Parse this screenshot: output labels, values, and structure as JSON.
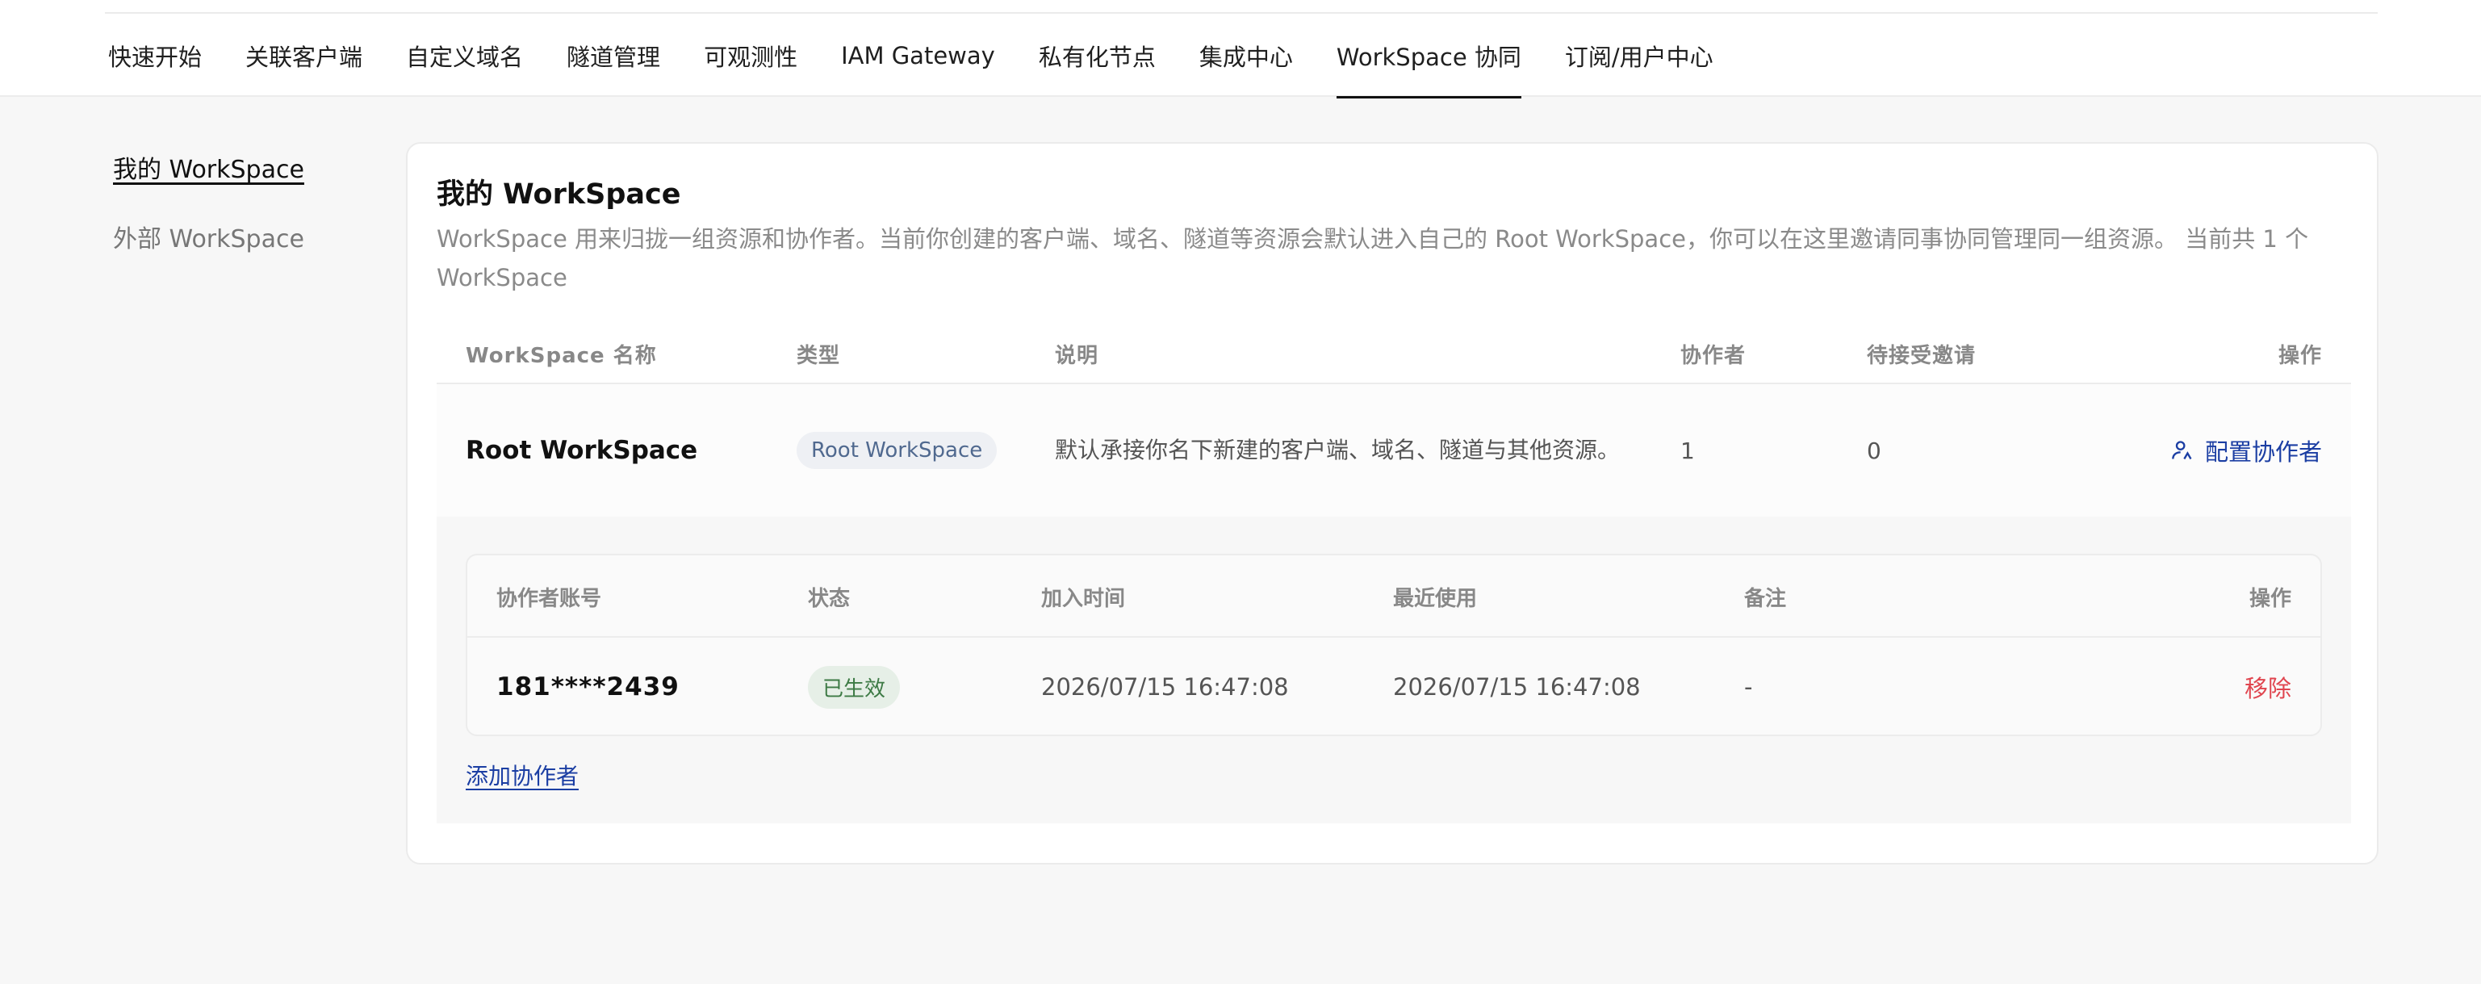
{
  "nav": {
    "tabs": [
      {
        "label": "快速开始"
      },
      {
        "label": "关联客户端"
      },
      {
        "label": "自定义域名"
      },
      {
        "label": "隧道管理"
      },
      {
        "label": "可观测性"
      },
      {
        "label": "IAM Gateway"
      },
      {
        "label": "私有化节点"
      },
      {
        "label": "集成中心"
      },
      {
        "label": "WorkSpace 协同",
        "active": true
      },
      {
        "label": "订阅/用户中心"
      }
    ]
  },
  "sidebar": {
    "items": [
      {
        "label": "我的 WorkSpace",
        "active": true
      },
      {
        "label": "外部 WorkSpace"
      }
    ]
  },
  "main": {
    "title": "我的 WorkSpace",
    "description": "WorkSpace 用来归拢一组资源和协作者。当前你创建的客户端、域名、隧道等资源会默认进入自己的 Root WorkSpace，你可以在这里邀请同事协同管理同一组资源。 当前共 1 个 WorkSpace",
    "table": {
      "headers": {
        "name": "WorkSpace 名称",
        "type": "类型",
        "desc": "说明",
        "collaborators": "协作者",
        "pending": "待接受邀请",
        "actions": "操作"
      },
      "row": {
        "name": "Root WorkSpace",
        "type": "Root WorkSpace",
        "desc": "默认承接你名下新建的客户端、域名、隧道与其他资源。",
        "collaborators": "1",
        "pending": "0",
        "action": "配置协作者"
      }
    },
    "collaborators": {
      "headers": {
        "account": "协作者账号",
        "status": "状态",
        "joined": "加入时间",
        "last_used": "最近使用",
        "note": "备注",
        "actions": "操作"
      },
      "row": {
        "account": "181****2439",
        "status": "已生效",
        "joined": "2026/07/15 16:47:08",
        "last_used": "2026/07/15 16:47:08",
        "note": "-",
        "action": "移除"
      },
      "add_label": "添加协作者"
    }
  },
  "colors": {
    "accent": "#1b3ea3",
    "danger": "#e0454f",
    "success_bg": "#e6efe7",
    "success_text": "#3d7a45"
  }
}
